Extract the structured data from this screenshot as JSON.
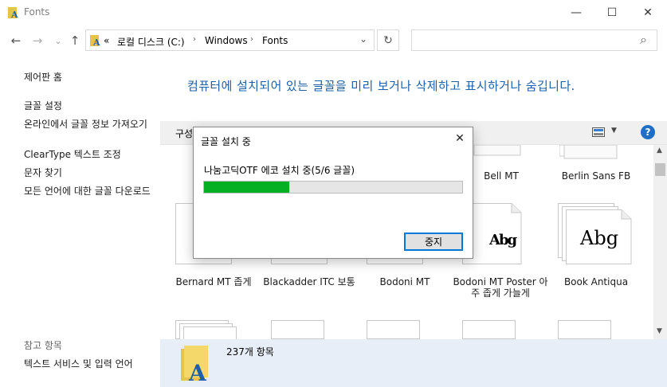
{
  "window": {
    "title": "Fonts"
  },
  "window_controls": {
    "minimize": "—",
    "maximize": "☐",
    "close": "✕"
  },
  "nav": {
    "back": "←",
    "forward": "→",
    "recent": "⌄",
    "up": "↑",
    "refresh": "↻",
    "search_icon": "⌕"
  },
  "address": {
    "overflow": "«",
    "crumbs": [
      "로컬 디스크 (C:)",
      "Windows",
      "Fonts"
    ],
    "sep": "›",
    "dropdown": "⌄"
  },
  "search": {
    "placeholder": ""
  },
  "left_panel": {
    "control_panel_home": "제어판 홈",
    "links": [
      "글꼴 설정",
      "온라인에서 글꼴 정보 가져오기",
      "ClearType 텍스트 조정",
      "문자 찾기",
      "모든 언어에 대한 글꼴 다운로드"
    ],
    "see_also_title": "참고 항목",
    "see_also_links": [
      "텍스트 서비스 및 입력 언어"
    ]
  },
  "main": {
    "heading": "컴퓨터에 설치되어 있는 글꼴을 미리 보거나 삭제하고 표시하거나 숨깁니다.",
    "toolbar": {
      "organize": "구성",
      "view_icon": "view-icon",
      "help": "?"
    },
    "tiles_row1": [
      "Bell MT",
      "Berlin Sans FB"
    ],
    "tiles_row2": [
      {
        "label": "Bernard MT 좁게",
        "sample": ""
      },
      {
        "label": "Blackadder ITC 보통",
        "sample": ""
      },
      {
        "label": "Bodoni MT",
        "sample": ""
      },
      {
        "label": "Bodoni MT Poster 아주 좁게 가늘게",
        "sample": "Abg"
      },
      {
        "label": "Book Antiqua",
        "sample": "Abg"
      }
    ]
  },
  "status": {
    "count": "237개 항목"
  },
  "dialog": {
    "title": "글꼴 설치 중",
    "close": "✕",
    "message": "나눔고딕OTF 에코 설치 중(5/6 글꼴)",
    "progress": 0.33,
    "stop_label": "중지"
  },
  "colors": {
    "accent": "#1e5fa8",
    "progress": "#06b025",
    "status_bg": "#e7eef7"
  }
}
